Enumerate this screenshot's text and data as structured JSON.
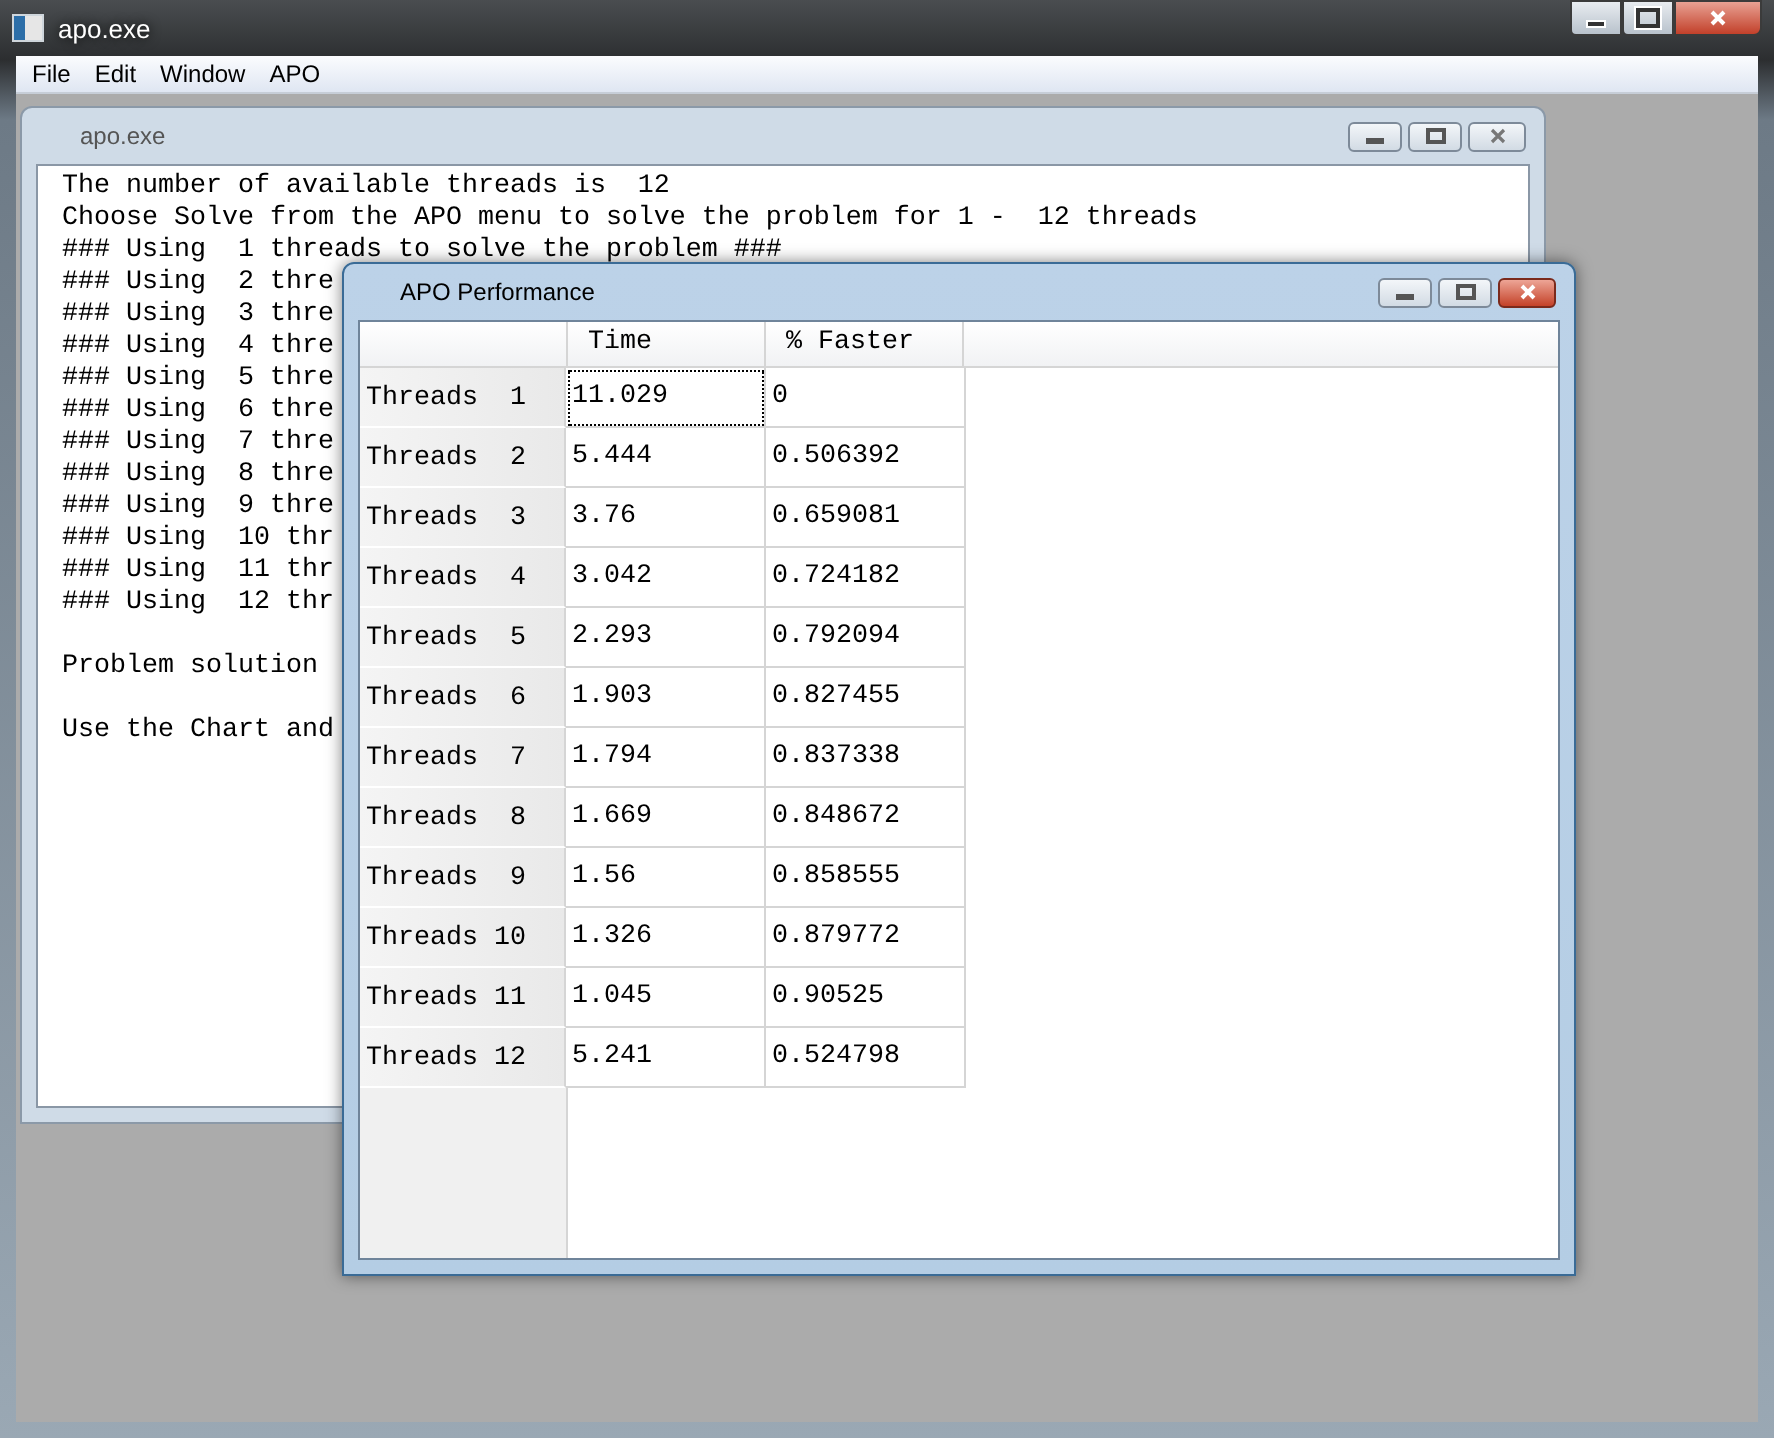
{
  "main_window": {
    "title": "apo.exe"
  },
  "menu": [
    "File",
    "Edit",
    "Window",
    "APO"
  ],
  "child_window": {
    "title": "apo.exe",
    "paragraphs": [
      [
        "The number of available threads is  12",
        "Choose Solve from the APO menu to solve the problem for 1 -  12 threads",
        "### Using  1 threads to solve the problem ###",
        "### Using  2 thre",
        "### Using  3 thre",
        "### Using  4 thre",
        "### Using  5 thre",
        "### Using  6 thre",
        "### Using  7 thre",
        "### Using  8 thre",
        "### Using  9 thre",
        "### Using  10 thr",
        "### Using  11 thr",
        "### Using  12 thr"
      ],
      [
        "Problem solution"
      ],
      [
        "Use the Chart and"
      ]
    ]
  },
  "performance_window": {
    "title": "APO Performance",
    "columns": [
      "Time",
      "% Faster"
    ],
    "rows": [
      {
        "label": "Threads  1",
        "time": "11.029",
        "faster": "0",
        "focused": true
      },
      {
        "label": "Threads  2",
        "time": "5.444",
        "faster": "0.506392",
        "focused": false
      },
      {
        "label": "Threads  3",
        "time": "3.76",
        "faster": "0.659081",
        "focused": false
      },
      {
        "label": "Threads  4",
        "time": "3.042",
        "faster": "0.724182",
        "focused": false
      },
      {
        "label": "Threads  5",
        "time": "2.293",
        "faster": "0.792094",
        "focused": false
      },
      {
        "label": "Threads  6",
        "time": "1.903",
        "faster": "0.827455",
        "focused": false
      },
      {
        "label": "Threads  7",
        "time": "1.794",
        "faster": "0.837338",
        "focused": false
      },
      {
        "label": "Threads  8",
        "time": "1.669",
        "faster": "0.848672",
        "focused": false
      },
      {
        "label": "Threads  9",
        "time": "1.56",
        "faster": "0.858555",
        "focused": false
      },
      {
        "label": "Threads 10",
        "time": "1.326",
        "faster": "0.879772",
        "focused": false
      },
      {
        "label": "Threads 11",
        "time": "1.045",
        "faster": "0.90525",
        "focused": false
      },
      {
        "label": "Threads 12",
        "time": "5.241",
        "faster": "0.524798",
        "focused": false
      }
    ]
  }
}
